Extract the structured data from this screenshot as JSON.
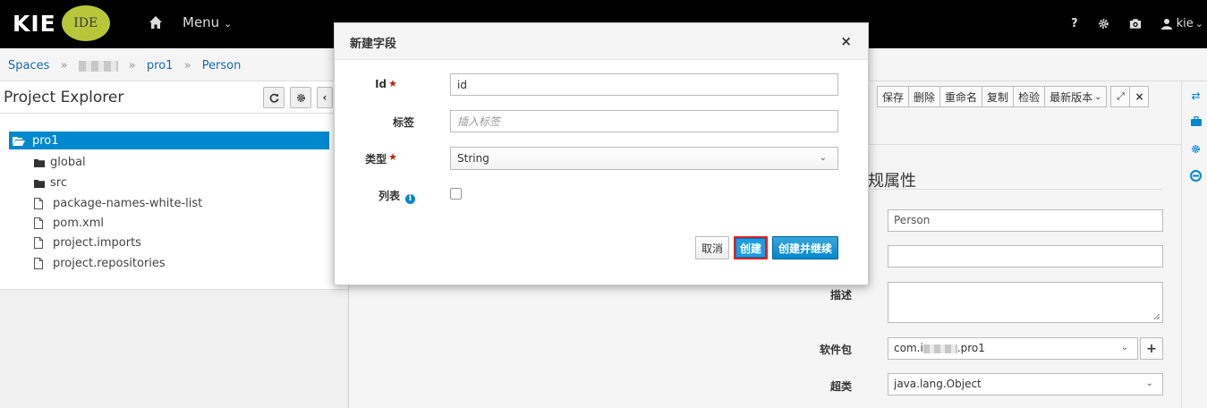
{
  "navbar": {
    "brand_kie": "KIE",
    "brand_ide": "IDE",
    "menu_label": "Menu",
    "help_label": "?",
    "user_label": "kie"
  },
  "breadcrumb": {
    "items": [
      "Spaces",
      "pro1",
      "Person"
    ],
    "separator": "»"
  },
  "project_explorer": {
    "title": "Project Explorer",
    "root": "pro1",
    "items": [
      {
        "type": "folder",
        "label": "global"
      },
      {
        "type": "folder",
        "label": "src"
      },
      {
        "type": "file",
        "label": "package-names-white-list"
      },
      {
        "type": "file",
        "label": "pom.xml"
      },
      {
        "type": "file",
        "label": "project.imports"
      },
      {
        "type": "file",
        "label": "project.repositories"
      }
    ]
  },
  "toolbar": {
    "save": "保存",
    "delete": "删除",
    "rename": "重命名",
    "copy": "复制",
    "validate": "检验",
    "latest_version": "最新版本"
  },
  "editor": {
    "section_title": "规属性",
    "name_value": "Person",
    "label_value": "",
    "description_label": "描述",
    "package_label": "软件包",
    "package_value_prefix": "com.i",
    "package_value_suffix": ".pro1",
    "superclass_label": "超类",
    "superclass_value": "java.lang.Object"
  },
  "modal": {
    "title": "新建字段",
    "close": "×",
    "id_label": "Id",
    "id_value": "id",
    "label_label": "标签",
    "label_placeholder": "插入标签",
    "type_label": "类型",
    "type_value": "String",
    "list_label": "列表",
    "list_checked": false,
    "cancel": "取消",
    "create": "创建",
    "create_continue": "创建并继续"
  },
  "colors": {
    "accent": "#0088ce",
    "required": "#c9190b",
    "navbar": "#000000",
    "brand_ide_bg": "#b8c73a"
  }
}
